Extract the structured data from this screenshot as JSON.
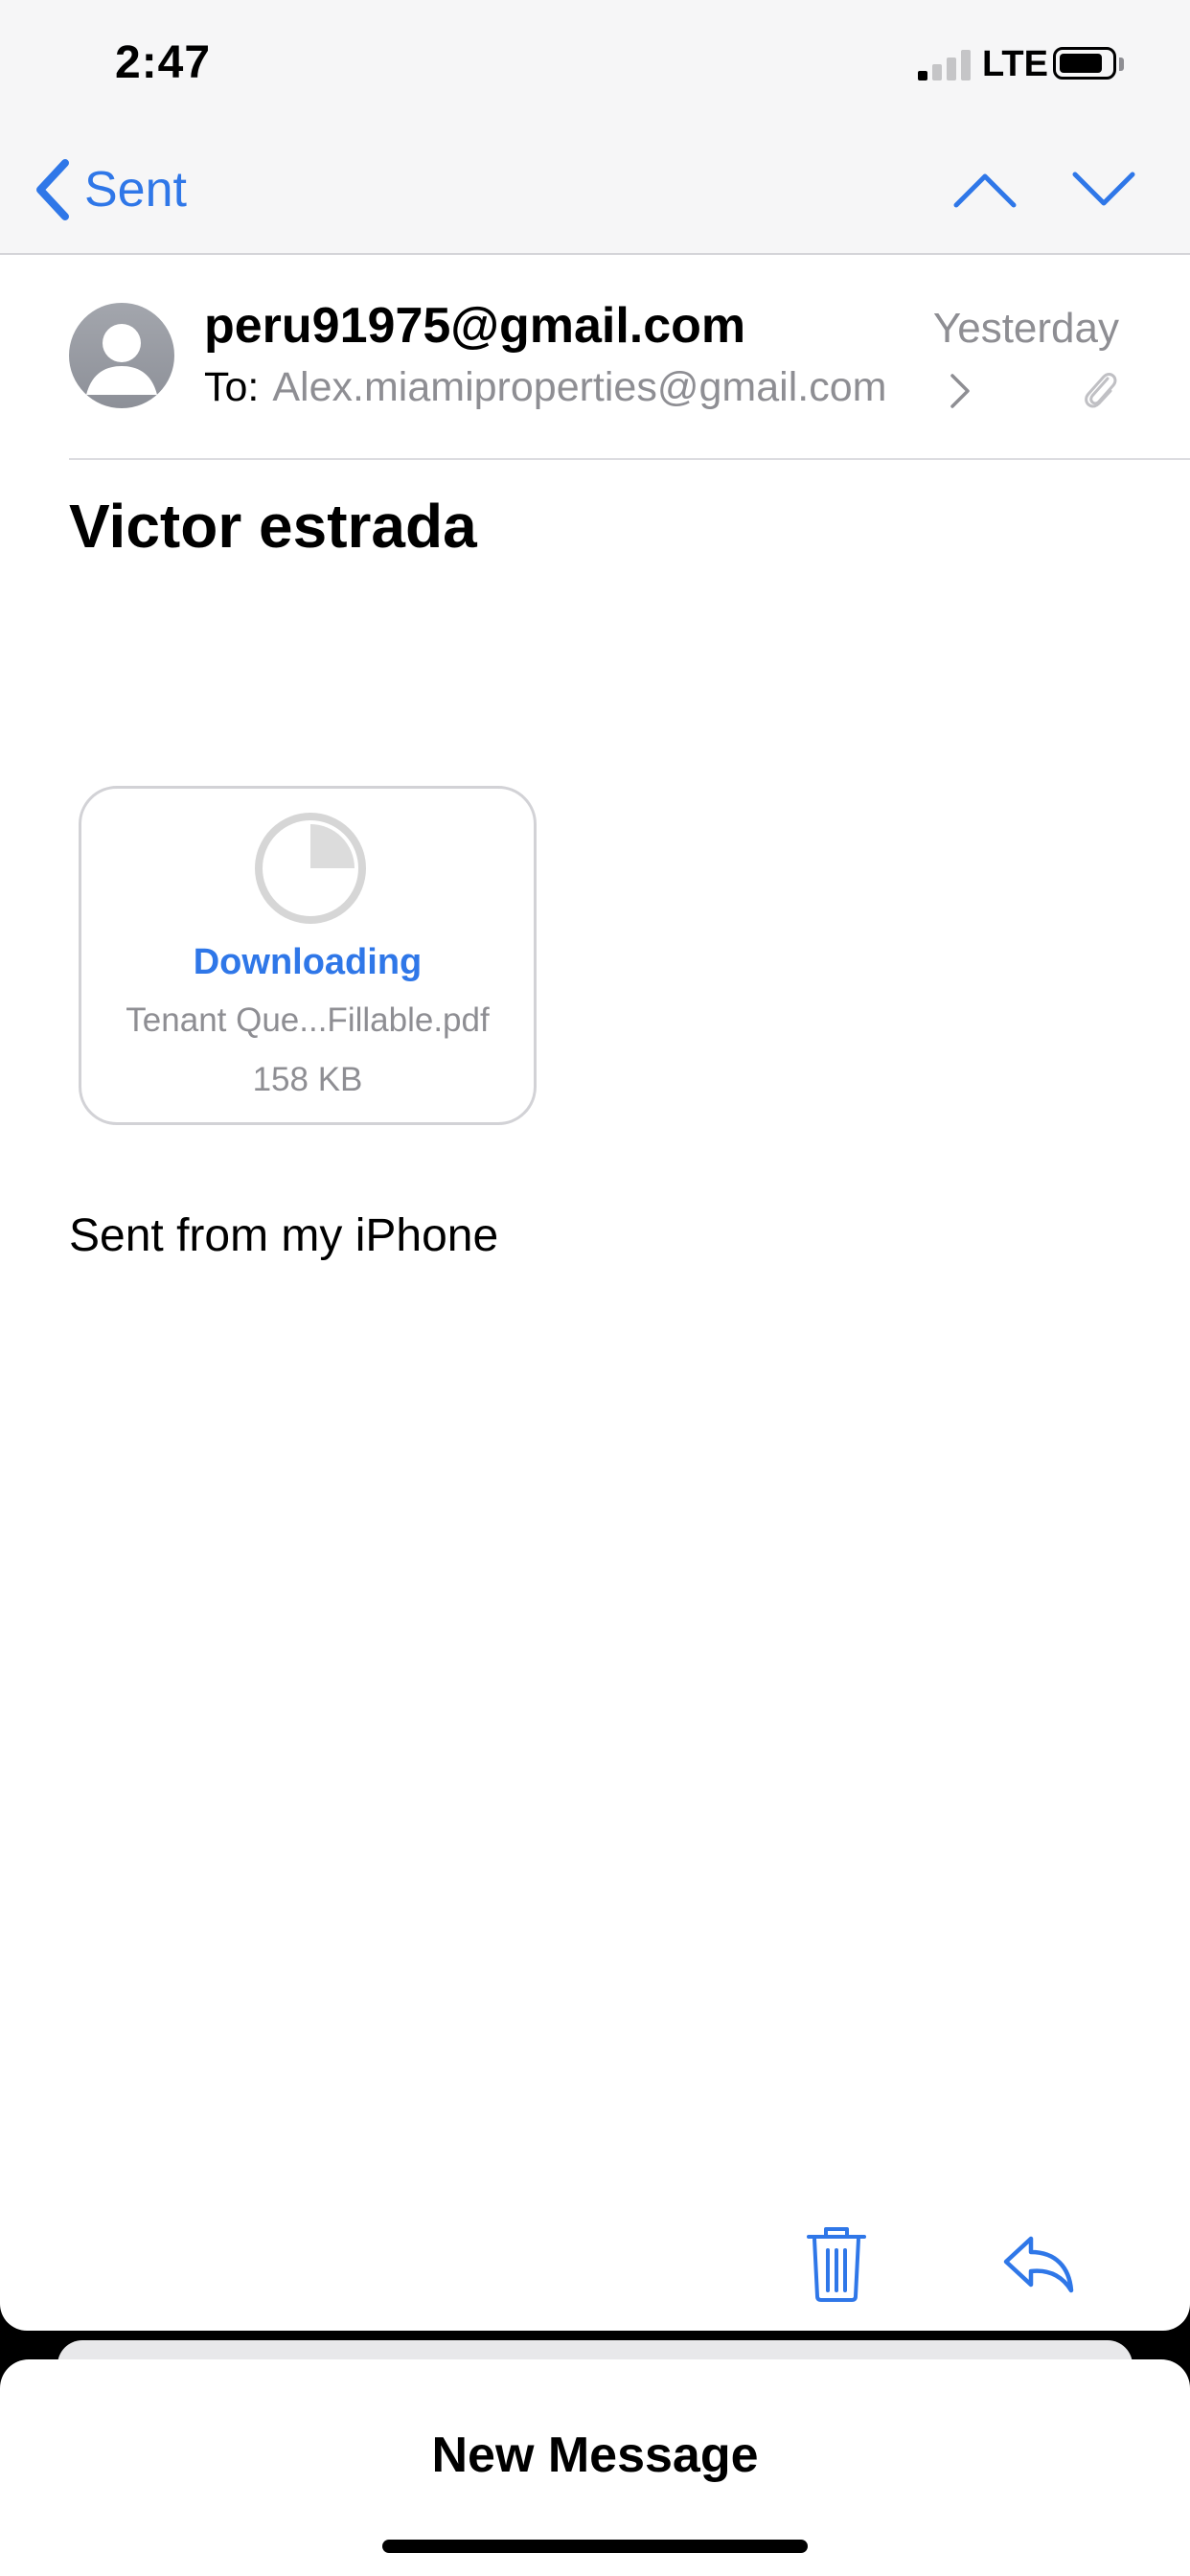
{
  "status_bar": {
    "time": "2:47",
    "network": "LTE",
    "signal_bars_active": 1,
    "signal_bars_total": 4
  },
  "nav": {
    "back_label": "Sent",
    "previous_icon": "chevron-up-icon",
    "next_icon": "chevron-down-icon"
  },
  "email": {
    "from": "peru91975@gmail.com",
    "date": "Yesterday",
    "to_label": "To:",
    "to": "Alex.miamiproperties@gmail.com",
    "subject": "Victor estrada",
    "attachment": {
      "status": "Downloading",
      "file_name": "Tenant Que...Fillable.pdf",
      "size": "158 KB",
      "download_progress": 0.25
    },
    "signature": "Sent from my iPhone"
  },
  "toolbar": {
    "trash_icon": "trash-icon",
    "reply_icon": "reply-icon"
  },
  "draft_sheet": {
    "title": "New Message"
  },
  "colors": {
    "accent": "#2f77e8",
    "secondary_text": "#8e8e93",
    "divider": "#dcdce0",
    "nav_background": "#f6f6f7"
  }
}
